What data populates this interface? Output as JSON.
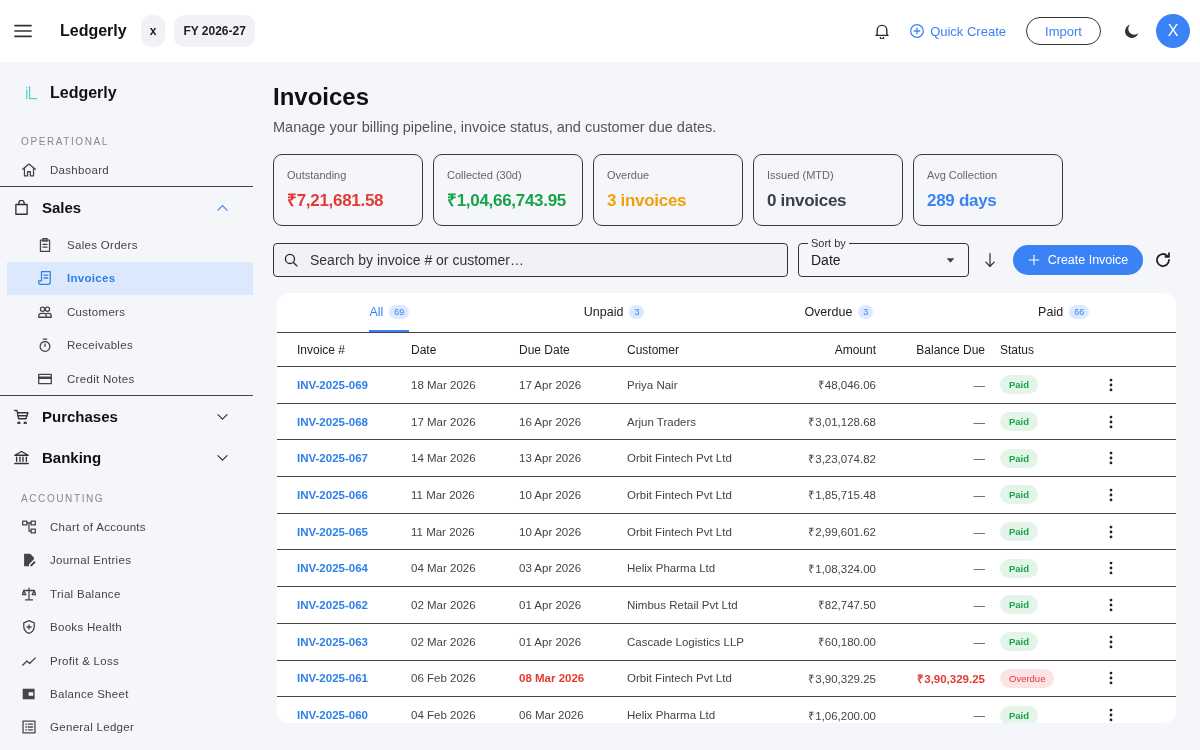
{
  "topbar": {
    "brand": "Ledgerly",
    "chips": [
      "x",
      "FY 2026-27"
    ],
    "quick_create": "Quick Create",
    "import_button": "Import",
    "avatar": "X"
  },
  "sidebar": {
    "brand": "Ledgerly",
    "nav": [
      {
        "kind": "heading",
        "label": "OPERATIONAL"
      },
      {
        "kind": "link",
        "label": "Dashboard",
        "selected": false
      },
      {
        "kind": "group",
        "label": "Sales",
        "expanded": true,
        "children": [
          {
            "label": "Sales Orders",
            "selected": false
          },
          {
            "label": "Invoices",
            "selected": true
          },
          {
            "label": "Customers",
            "selected": false
          },
          {
            "label": "Receivables",
            "selected": false
          },
          {
            "label": "Credit Notes",
            "selected": false
          }
        ]
      },
      {
        "kind": "group",
        "label": "Purchases",
        "expanded": false
      },
      {
        "kind": "group",
        "label": "Banking",
        "expanded": false
      },
      {
        "kind": "heading",
        "label": "ACCOUNTING"
      },
      {
        "kind": "link",
        "label": "Chart of Accounts",
        "selected": false
      },
      {
        "kind": "link",
        "label": "Journal Entries",
        "selected": false
      },
      {
        "kind": "link",
        "label": "Trial Balance",
        "selected": false
      },
      {
        "kind": "link",
        "label": "Books Health",
        "selected": false
      },
      {
        "kind": "link",
        "label": "Profit & Loss",
        "selected": false
      },
      {
        "kind": "link",
        "label": "Balance Sheet",
        "selected": false
      },
      {
        "kind": "link",
        "label": "General Ledger",
        "selected": false
      }
    ]
  },
  "page": {
    "title": "Invoices",
    "subtitle": "Manage your billing pipeline, invoice status, and customer due dates.",
    "stats": [
      {
        "label": "Outstanding",
        "value": "₹7,21,681.58",
        "color": "#e53935"
      },
      {
        "label": "Collected (30d)",
        "value": "₹1,04,66,743.95",
        "color": "#16a34a"
      },
      {
        "label": "Overdue",
        "value": "3 invoices",
        "color": "#f59e0b"
      },
      {
        "label": "Issued (MTD)",
        "value": "0 invoices",
        "color": "#374151"
      },
      {
        "label": "Avg Collection",
        "value": "289 days",
        "color": "#3b82f6"
      }
    ],
    "search": {
      "placeholder": "Search by invoice # or customer…"
    },
    "sort": {
      "label": "Sort by",
      "value": "Date"
    },
    "create_button": "Create Invoice",
    "tabs": [
      {
        "label": "All",
        "count": "69",
        "selected": true
      },
      {
        "label": "Unpaid",
        "count": "3",
        "selected": false
      },
      {
        "label": "Overdue",
        "count": "3",
        "selected": false
      },
      {
        "label": "Paid",
        "count": "66",
        "selected": false
      }
    ],
    "table": {
      "columns": [
        "Invoice #",
        "Date",
        "Due Date",
        "Customer",
        "Amount",
        "Balance Due",
        "Status"
      ],
      "rows": [
        {
          "invoice": "INV-2025-069",
          "date": "18 Mar 2026",
          "due_date": "17 Apr 2026",
          "customer": "Priya Nair",
          "amount": "₹48,046.06",
          "balance_due": "—",
          "status": "Paid",
          "overdue": false
        },
        {
          "invoice": "INV-2025-068",
          "date": "17 Mar 2026",
          "due_date": "16 Apr 2026",
          "customer": "Arjun Traders",
          "amount": "₹3,01,128.68",
          "balance_due": "—",
          "status": "Paid",
          "overdue": false
        },
        {
          "invoice": "INV-2025-067",
          "date": "14 Mar 2026",
          "due_date": "13 Apr 2026",
          "customer": "Orbit Fintech Pvt Ltd",
          "amount": "₹3,23,074.82",
          "balance_due": "—",
          "status": "Paid",
          "overdue": false
        },
        {
          "invoice": "INV-2025-066",
          "date": "11 Mar 2026",
          "due_date": "10 Apr 2026",
          "customer": "Orbit Fintech Pvt Ltd",
          "amount": "₹1,85,715.48",
          "balance_due": "—",
          "status": "Paid",
          "overdue": false
        },
        {
          "invoice": "INV-2025-065",
          "date": "11 Mar 2026",
          "due_date": "10 Apr 2026",
          "customer": "Orbit Fintech Pvt Ltd",
          "amount": "₹2,99,601.62",
          "balance_due": "—",
          "status": "Paid",
          "overdue": false
        },
        {
          "invoice": "INV-2025-064",
          "date": "04 Mar 2026",
          "due_date": "03 Apr 2026",
          "customer": "Helix Pharma Ltd",
          "amount": "₹1,08,324.00",
          "balance_due": "—",
          "status": "Paid",
          "overdue": false
        },
        {
          "invoice": "INV-2025-062",
          "date": "02 Mar 2026",
          "due_date": "01 Apr 2026",
          "customer": "Nimbus Retail Pvt Ltd",
          "amount": "₹82,747.50",
          "balance_due": "—",
          "status": "Paid",
          "overdue": false
        },
        {
          "invoice": "INV-2025-063",
          "date": "02 Mar 2026",
          "due_date": "01 Apr 2026",
          "customer": "Cascade Logistics LLP",
          "amount": "₹60,180.00",
          "balance_due": "—",
          "status": "Paid",
          "overdue": false
        },
        {
          "invoice": "INV-2025-061",
          "date": "06 Feb 2026",
          "due_date": "08 Mar 2026",
          "customer": "Orbit Fintech Pvt Ltd",
          "amount": "₹3,90,329.25",
          "balance_due": "₹3,90,329.25",
          "status": "Overdue",
          "overdue": true
        },
        {
          "invoice": "INV-2025-060",
          "date": "04 Feb 2026",
          "due_date": "06 Mar 2026",
          "customer": "Helix Pharma Ltd",
          "amount": "₹1,06,200.00",
          "balance_due": "—",
          "status": "Paid",
          "overdue": false
        }
      ]
    }
  }
}
